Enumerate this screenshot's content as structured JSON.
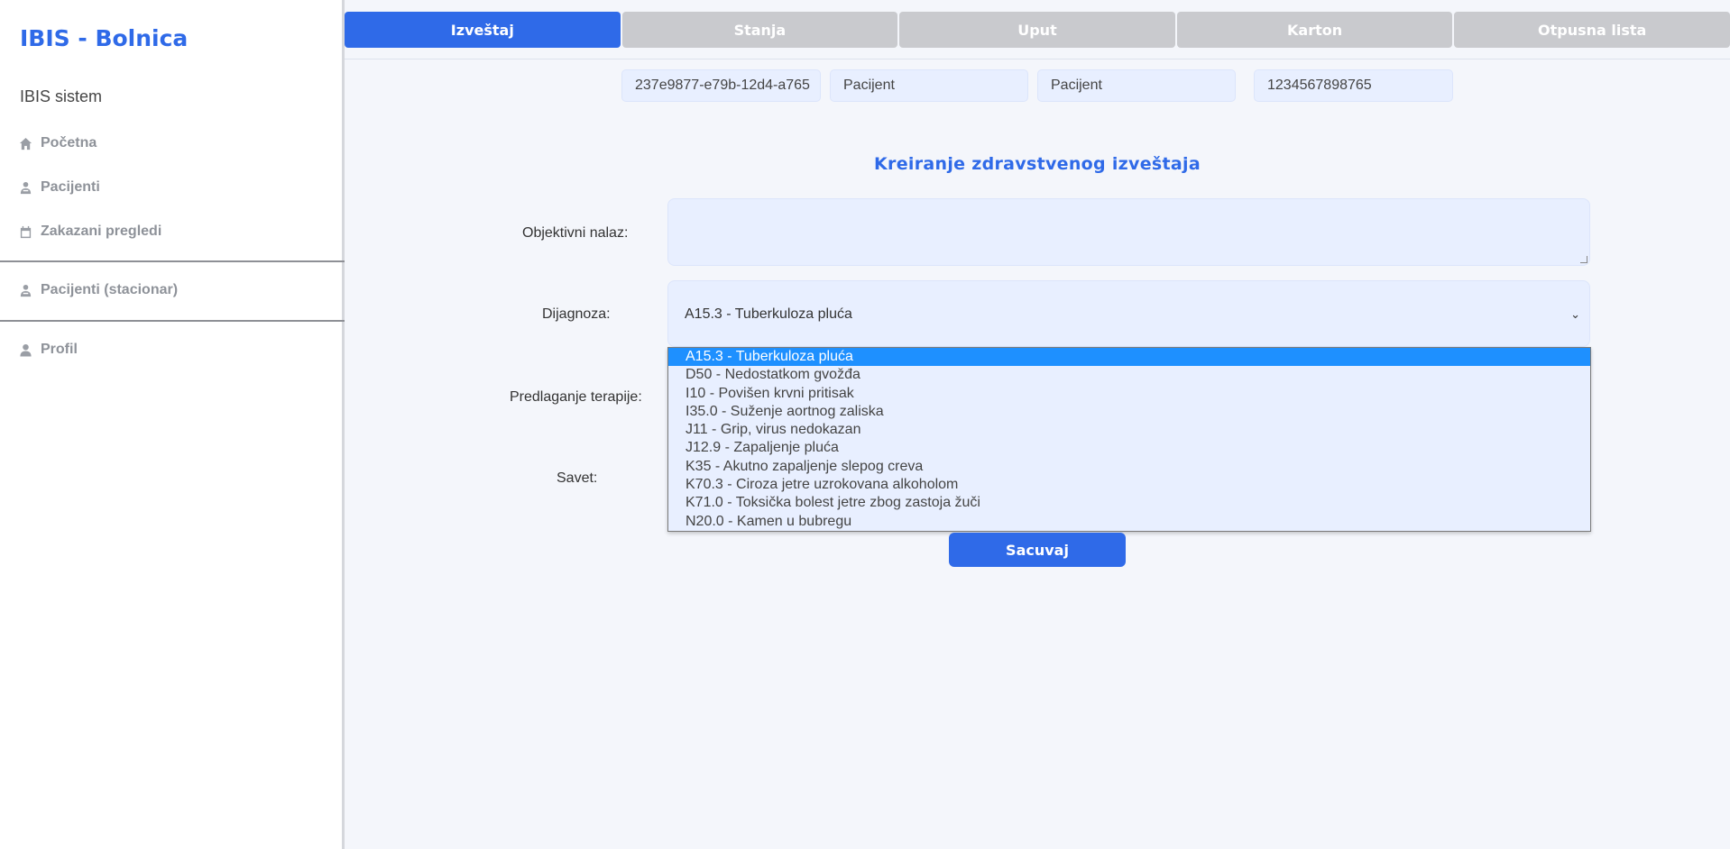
{
  "sidebar": {
    "brand": "IBIS - Bolnica",
    "system": "IBIS sistem",
    "items": [
      {
        "label": "Početna",
        "icon": "home-icon"
      },
      {
        "label": "Pacijenti",
        "icon": "patient-icon"
      },
      {
        "label": "Zakazani pregledi",
        "icon": "calendar-icon"
      },
      {
        "label": "Pacijenti (stacionar)",
        "icon": "patient-icon"
      },
      {
        "label": "Profil",
        "icon": "user-icon"
      }
    ]
  },
  "tabs": [
    {
      "label": "Izveštaj",
      "active": true
    },
    {
      "label": "Stanja",
      "active": false
    },
    {
      "label": "Uput",
      "active": false
    },
    {
      "label": "Karton",
      "active": false
    },
    {
      "label": "Otpusna lista",
      "active": false
    }
  ],
  "patient_info": {
    "id": "237e9877-e79b-12d4-a765",
    "first_name": "Pacijent",
    "last_name": "Pacijent",
    "jmbg": "1234567898765"
  },
  "form": {
    "title": "Kreiranje zdravstvenog izveštaja",
    "objective_label": "Objektivni nalaz:",
    "objective_value": "",
    "diagnosis_label": "Dijagnoza:",
    "diagnosis_selected": "A15.3 - Tuberkuloza pluća",
    "therapy_label": "Predlaganje terapije:",
    "advice_label": "Savet:",
    "diagnosis_options": [
      "A15.3 - Tuberkuloza pluća",
      "D50 - Nedostatkom gvožđa",
      "I10 - Povišen krvni pritisak",
      "I35.0 - Suženje aortnog zaliska",
      "J11 - Grip, virus nedokazan",
      "J12.9 - Zapaljenje pluća",
      "K35 - Akutno zapaljenje slepog creva",
      "K70.3 - Ciroza jetre uzrokovana alkoholom",
      "K71.0 - Toksička bolest jetre zbog zastoja žuči",
      "N20.0 - Kamen u bubregu"
    ],
    "save_label": "Sacuvaj"
  },
  "colors": {
    "accent": "#2f6ae8",
    "tab_inactive": "#c9cace",
    "field_bg": "#e8efff",
    "option_selected": "#1e90ff"
  }
}
